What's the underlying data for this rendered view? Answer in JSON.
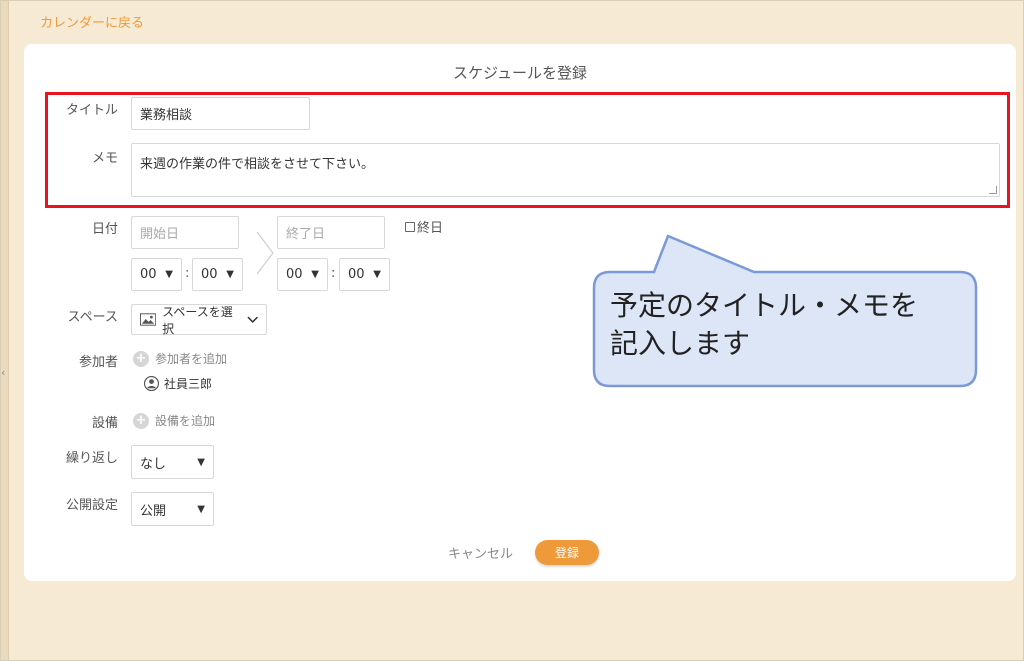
{
  "nav": {
    "back_label": "カレンダーに戻る"
  },
  "form": {
    "title": "スケジュールを登録",
    "title_field": {
      "label": "タイトル",
      "value": "業務相談"
    },
    "memo_field": {
      "label": "メモ",
      "value": "来週の作業の件で相談をさせて下さい。"
    },
    "date_field": {
      "label": "日付",
      "start_placeholder": "開始日",
      "end_placeholder": "終了日",
      "start_hour": "00",
      "start_minute": "00",
      "end_hour": "00",
      "end_minute": "00",
      "time_separator": ":",
      "all_day_label": "終日"
    },
    "space_field": {
      "label": "スペース",
      "button_label": "スペースを選択"
    },
    "participants_field": {
      "label": "参加者",
      "add_label": "参加者を追加",
      "members": [
        "社員三郎"
      ]
    },
    "equipment_field": {
      "label": "設備",
      "add_label": "設備を追加"
    },
    "repeat_field": {
      "label": "繰り返し",
      "value": "なし"
    },
    "visibility_field": {
      "label": "公開設定",
      "value": "公開"
    },
    "actions": {
      "cancel_label": "キャンセル",
      "submit_label": "登録"
    }
  },
  "annotation": {
    "callout_line1": "予定のタイトル・メモを",
    "callout_line2": "記入します"
  },
  "colors": {
    "accent": "#ee9a3a",
    "background": "#f6ead4",
    "highlight": "#e8141e",
    "callout_fill": "#dde6f6",
    "callout_stroke": "#7a99d6"
  }
}
